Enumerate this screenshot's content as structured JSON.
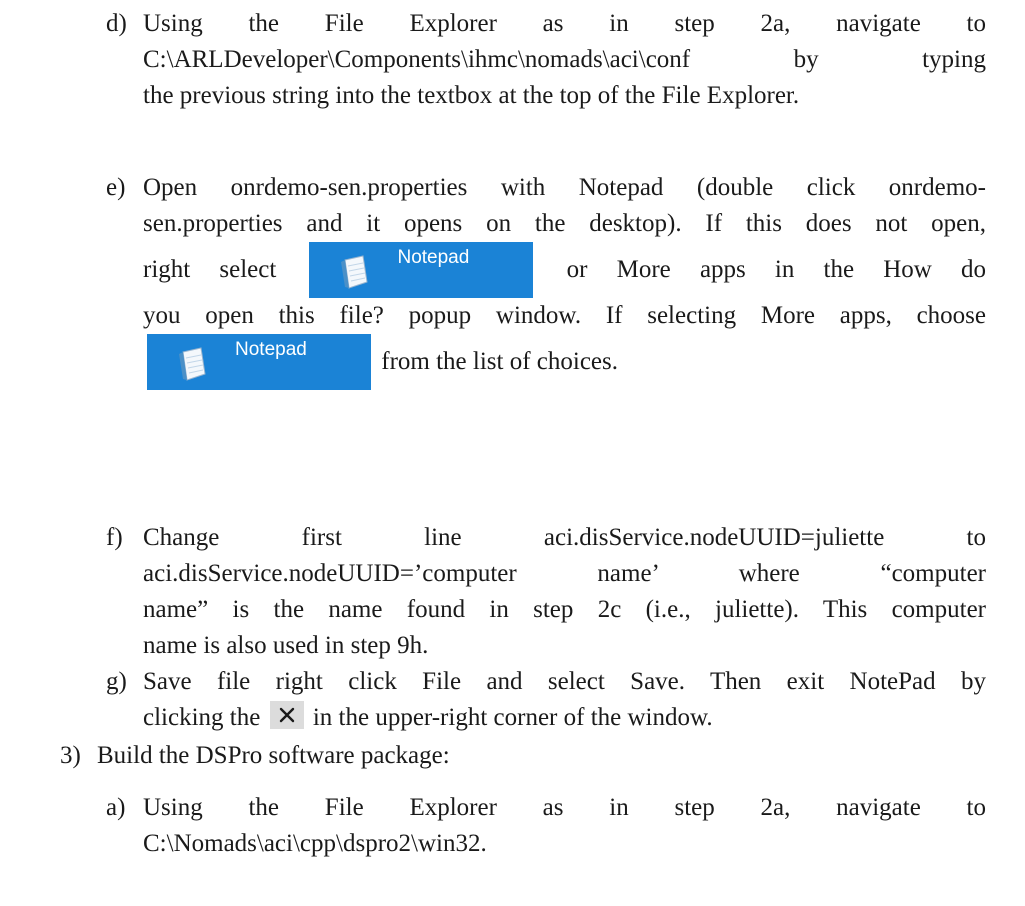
{
  "steps": {
    "d": {
      "marker": "d)",
      "line1": "Using the File Explorer as in step 2a, navigate to",
      "line2": "C:\\ARLDeveloper\\Components\\ihmc\\nomads\\aci\\conf by typing",
      "line3": "the previous string into the textbox at the top of the File Explorer."
    },
    "e": {
      "marker": "e)",
      "line1": "Open onrdemo-sen.properties with Notepad (double click onrdemo-",
      "line2": "sen.properties and it opens on the desktop). If this does not open,",
      "line3a": "right select",
      "line3b": "or More apps in the How do",
      "line4": "you open this file? popup window. If selecting More apps, choose",
      "line5b": "from the list of choices.",
      "chip_label": "Notepad"
    },
    "f": {
      "marker": "f)",
      "line1": "Change first line aci.disService.nodeUUID=juliette to",
      "line2": "aci.disService.nodeUUID=’computer name’ where “computer",
      "line3": "name” is the name found in step 2c (i.e., juliette). This computer",
      "line4": "name is also used in step 9h."
    },
    "g": {
      "marker": "g)",
      "line1": "Save file right click File and select Save. Then exit NotePad by",
      "line2a": "clicking the",
      "line2b": "in the upper-right corner of the window."
    },
    "s3": {
      "marker": "3)",
      "text": "Build the DSPro software package:"
    },
    "a": {
      "marker": "a)",
      "line1": "Using the File Explorer as in step 2a, navigate to",
      "line2": "C:\\Nomads\\aci\\cpp\\dspro2\\win32."
    }
  },
  "colors": {
    "chip": "#1b83d6",
    "close_box": "#dcdcdc"
  },
  "icons": {
    "notepad": "notepad-icon",
    "close": "close-icon"
  }
}
